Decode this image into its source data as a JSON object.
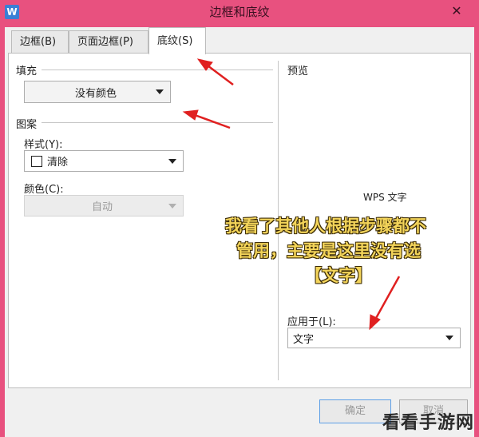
{
  "window": {
    "title": "边框和底纹",
    "app_icon": "W",
    "close_glyph": "✕"
  },
  "tabs": [
    {
      "label": "边框(B)"
    },
    {
      "label": "页面边框(P)"
    },
    {
      "label": "底纹(S)"
    }
  ],
  "fill": {
    "label": "填充",
    "color_value": "没有颜色"
  },
  "pattern": {
    "label": "图案",
    "style_label": "样式(Y):",
    "style_value": "清除",
    "color_label": "颜色(C):",
    "color_value": "自动"
  },
  "preview": {
    "label": "预览",
    "sample_text": "WPS 文字"
  },
  "apply_to": {
    "label": "应用于(L):",
    "value": "文字"
  },
  "annotation": {
    "line1": "我看了其他人根据步骤都不",
    "line2": "管用，主要是这里没有选",
    "line3": "【文字】"
  },
  "buttons": {
    "ok": "确定",
    "cancel": "取消"
  },
  "watermark": "看看手游网",
  "colors": {
    "titlebar": "#e8517f",
    "annotation_text": "#f3d45a",
    "arrow": "#e02020"
  }
}
